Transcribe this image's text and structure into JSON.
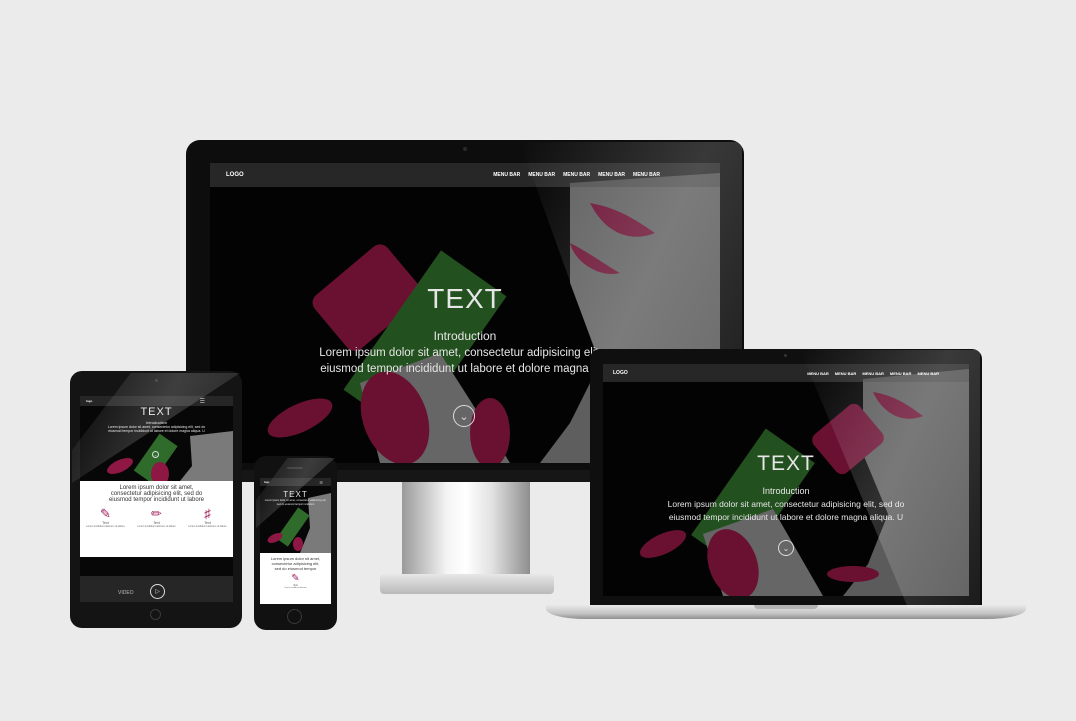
{
  "desktop": {
    "logo": "LOGO",
    "menu": [
      "MENU BAR",
      "MENU BAR",
      "MENU BAR",
      "MENU BAR",
      "MENU BAR"
    ],
    "hero_title": "TEXT",
    "hero_subtitle": "Introduction",
    "hero_body_line1": "Lorem ipsum dolor sit amet, consectetur adipisicing elit, s",
    "hero_body_line2": "eiusmod tempor incididunt ut labore et dolore magna aliq"
  },
  "laptop": {
    "logo": "LOGO",
    "menu": [
      "MENU BAR",
      "MENU BAR",
      "MENU BAR",
      "MENU BAR",
      "MENU BAR"
    ],
    "hero_title": "TEXT",
    "hero_subtitle": "Introduction",
    "hero_body_line1": "Lorem ipsum dolor sit amet, consectetur adipisicing elit, sed do",
    "hero_body_line2": "eiusmod tempor incididunt ut labore et dolore magna aliqua. U"
  },
  "tablet": {
    "logo": "logo",
    "hero_title": "TEXT",
    "hero_subtitle": "Introduction",
    "hero_body_line1": "Lorem ipsum dolor sit amet, consectetur adipisicing elit, sed do",
    "hero_body_line2": "eiusmod tempor incididunt ut labore et dolore magna aliqua. U",
    "panel_line1": "Lorem ipsum dolor sit amet,",
    "panel_line2": "consectetur adipisicing elit, sed do",
    "panel_line3": "eiusmod tempor incididunt ut labore",
    "features": [
      {
        "icon": "tablet-pen-icon",
        "label": "Text",
        "sub": "Lorem incididunt dolorem ut labore"
      },
      {
        "icon": "pencil-icon",
        "label": "Text",
        "sub": "Lorem incididunt dolorem ut labore"
      },
      {
        "icon": "tools-icon",
        "label": "Text",
        "sub": "Lorem incididunt dolorem ut labore"
      }
    ],
    "video_label": "VIDEO"
  },
  "phone": {
    "logo": "logo",
    "hero_title": "TEXT",
    "hero_body": "Lorem ipsum dolor sit amet, consectetur adipisicing elit, sed do eiusmod tempor incididunt",
    "panel_line1": "Lorem ipsum dolor sit amet,",
    "panel_line2": "consectetur adipisicing elit,",
    "panel_line3": "sed do eiusmod tempor",
    "feature_label": "Text",
    "feature_sub": "Lorem incididunt dolorem"
  },
  "colors": {
    "background": "#ebebeb",
    "accent": "#a21f5d",
    "lipstick": "#8e1743",
    "lipstick_case": "#2f6b2a"
  }
}
